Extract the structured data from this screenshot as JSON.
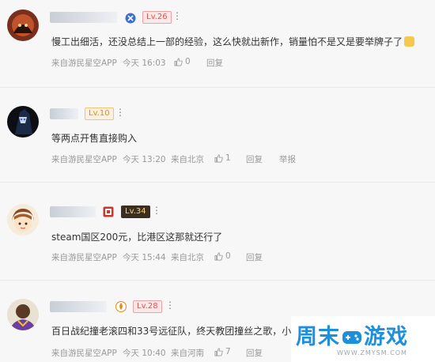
{
  "comments": [
    {
      "level": "Lv.26",
      "text": "慢工出细活，还没总结上一部的经验，这么快就出新作，销量怕不是又是要举牌子了",
      "source": "来自游民星空APP",
      "time": "今天 16:03",
      "location": "",
      "likes": "0",
      "reply": "回复",
      "report": ""
    },
    {
      "level": "Lv.10",
      "text": "等两点开售直接购入",
      "source": "来自游民星空APP",
      "time": "今天 13:20",
      "location": "来自北京",
      "likes": "1",
      "reply": "回复",
      "report": "举报"
    },
    {
      "level": "Lv.34",
      "text": "steam国区200元，比港区这那就还行了",
      "source": "来自游民星空APP",
      "time": "今天 15:44",
      "location": "来自北京",
      "likes": "0",
      "reply": "回复",
      "report": ""
    },
    {
      "level": "Lv.28",
      "text": "百日战纪撞老滚四和33号远征队，终天教团撞丝之歌，小",
      "source": "来自游民星空APP",
      "time": "今天 10:40",
      "location": "来自河南",
      "likes": "7",
      "reply": "回复",
      "report": ""
    }
  ],
  "more_label": "⋮",
  "watermark": {
    "title_a": "周末",
    "title_b": "游戏",
    "url": "WWW.ZMYSM.COM"
  },
  "colors": {
    "accent": "#1e8fdb",
    "badge_red": "#e05050",
    "badge_orange": "#e58a12"
  }
}
